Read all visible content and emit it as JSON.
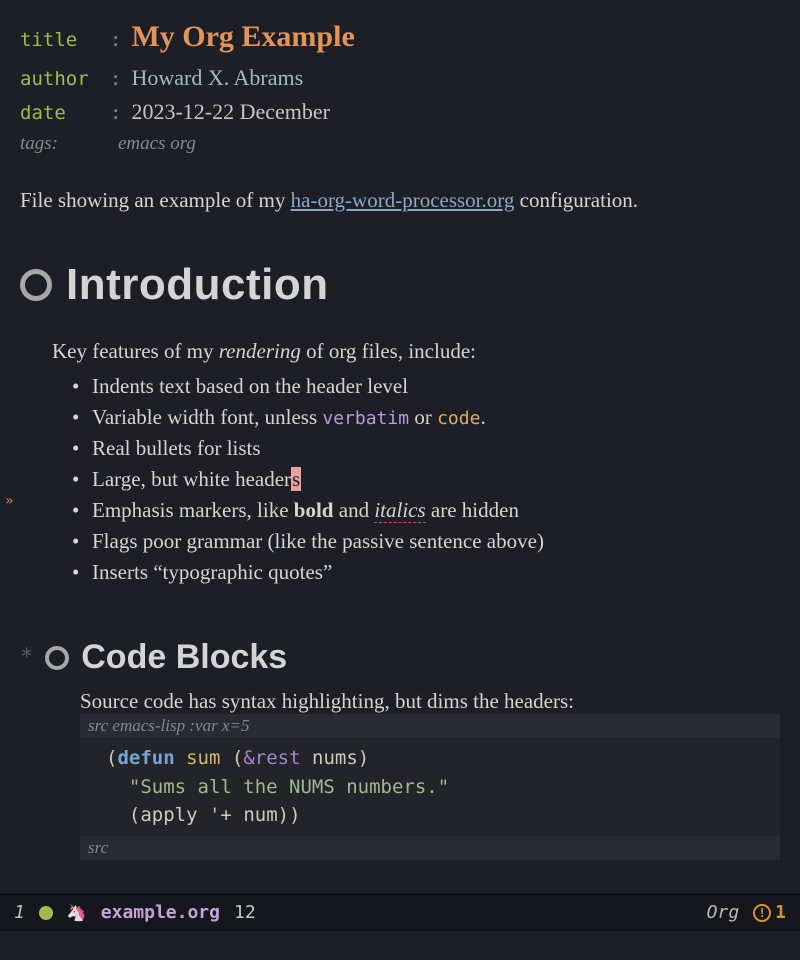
{
  "meta": {
    "title_key": "title",
    "title_val": "My Org Example",
    "author_key": "author",
    "author_val": "Howard X. Abrams",
    "date_key": "date",
    "date_val": "2023-12-22 December",
    "tags_key": "tags:",
    "tags_val": "emacs org"
  },
  "intro": {
    "before_link": "File showing an example of my ",
    "link_text": "ha-org-word-processor.org",
    "after_link": " configuration."
  },
  "section1": {
    "heading": "Introduction",
    "lead_before": "Key features of my ",
    "lead_italic": "rendering",
    "lead_after": " of org files, include:",
    "items": {
      "i0": "Indents text based on the header level",
      "i1a": "Variable width font, unless ",
      "i1_verbatim": "verbatim",
      "i1b": " or ",
      "i1_code": "code",
      "i1c": ".",
      "i2": "Real bullets for lists",
      "i3a": "Large, but white header",
      "i3_cursor": "s",
      "i4a": "Emphasis markers, like ",
      "i4_bold": "bold",
      "i4b": " and ",
      "i4_italics": "italics",
      "i4c": " are hidden",
      "i5": "Flags poor grammar (like the passive sentence above)",
      "i6": "Inserts “typographic quotes”"
    }
  },
  "section2": {
    "heading": "Code Blocks",
    "intro": "Source code has syntax highlighting, but dims the headers:",
    "src_header_kw": "src",
    "src_header_lang": " emacs-lisp :var x=5",
    "src_footer": "src",
    "code": {
      "l1_kw": "defun",
      "l1_name": "sum",
      "l1_amp": "&rest",
      "l1_arg": "nums",
      "l2_doc": "\"Sums all the NUMS numbers.\"",
      "l3_fn": "apply",
      "l3_sym": "'+",
      "l3_arg": "num"
    }
  },
  "modeline": {
    "window": "1",
    "filename": "example.org",
    "line": "12",
    "major_mode": "Org",
    "warn_count": "1"
  }
}
